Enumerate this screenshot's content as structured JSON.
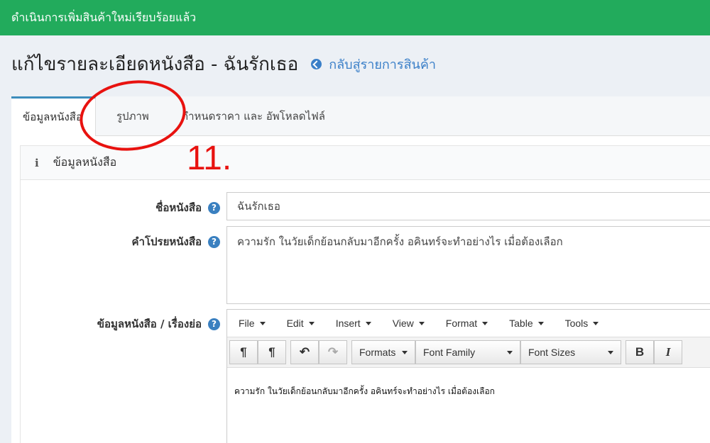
{
  "alert": {
    "message": "ดำเนินการเพิ่มสินค้าใหม่เรียบร้อยแล้ว",
    "color": "#22ab5c"
  },
  "page": {
    "title": "แก้ไขรายละเอียดหนังสือ - ฉันรักเธอ",
    "back_link": "กลับสู่รายการสินค้า"
  },
  "tabs": [
    {
      "label": "ข้อมูลหนังสือ",
      "active": true
    },
    {
      "label": "รูปภาพ",
      "active": false
    },
    {
      "label": "กำหนดราคา และ อัพโหลดไฟล์",
      "active": false
    }
  ],
  "annotation": {
    "number": "11.",
    "color": "#e8120f"
  },
  "panel": {
    "icon": "info-icon",
    "title": "ข้อมูลหนังสือ"
  },
  "form": {
    "name_label": "ชื่อหนังสือ",
    "name_value": "ฉันรักเธอ",
    "desc_label": "คำโปรยหนังสือ",
    "desc_value": "ความรัก ในวัยเด็กย้อนกลับมาอีกครั้ง อคินทร์จะทำอย่างไร เมื่อต้องเลือก",
    "summary_label": "ข้อมูลหนังสือ / เรื่องย่อ",
    "help": "?"
  },
  "editor": {
    "menu": [
      "File",
      "Edit",
      "Insert",
      "View",
      "Format",
      "Table",
      "Tools"
    ],
    "toolbar": {
      "ltr": "¶",
      "rtl": "¶",
      "undo": "↶",
      "redo": "↷",
      "formats": "Formats",
      "font_family": "Font Family",
      "font_sizes": "Font Sizes",
      "bold": "B",
      "italic": "I"
    },
    "content": "ความรัก ในวัยเด็กย้อนกลับมาอีกครั้ง อคินทร์จะทำอย่างไร เมื่อต้องเลือก"
  }
}
